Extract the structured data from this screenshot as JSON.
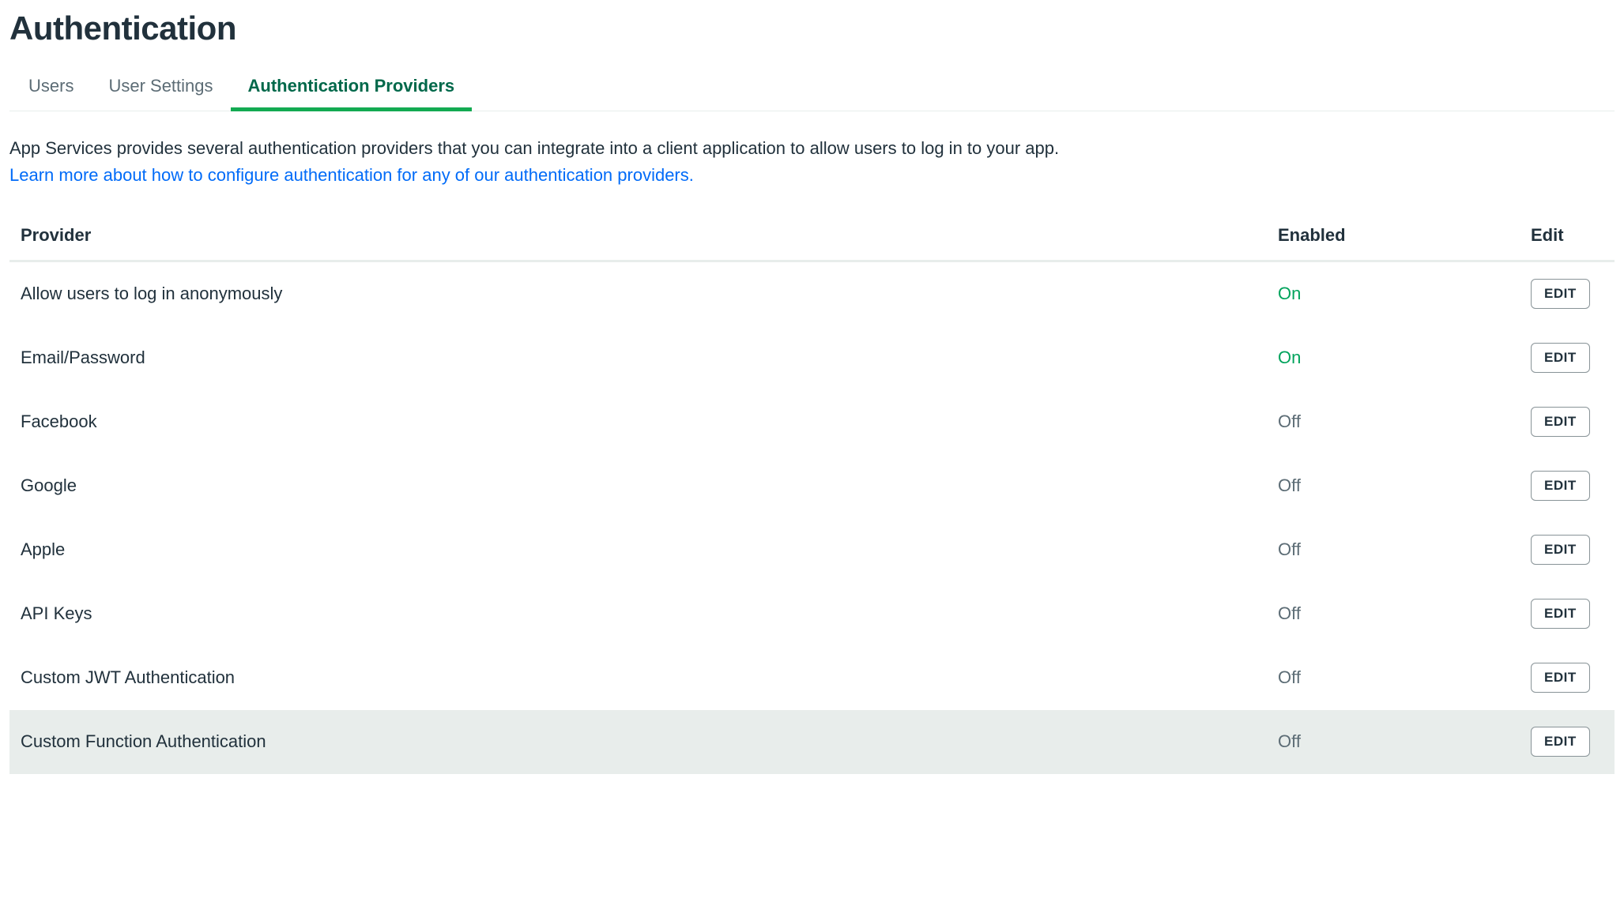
{
  "page": {
    "title": "Authentication"
  },
  "tabs": [
    {
      "label": "Users",
      "active": false
    },
    {
      "label": "User Settings",
      "active": false
    },
    {
      "label": "Authentication Providers",
      "active": true
    }
  ],
  "description": {
    "text": "App Services provides several authentication providers that you can integrate into a client application to allow users to log in to your app.",
    "link": "Learn more about how to configure authentication for any of our authentication providers."
  },
  "table": {
    "headers": {
      "provider": "Provider",
      "enabled": "Enabled",
      "edit": "Edit"
    },
    "editLabel": "EDIT",
    "rows": [
      {
        "provider": "Allow users to log in anonymously",
        "enabled": "On",
        "highlight": false
      },
      {
        "provider": "Email/Password",
        "enabled": "On",
        "highlight": false
      },
      {
        "provider": "Facebook",
        "enabled": "Off",
        "highlight": false
      },
      {
        "provider": "Google",
        "enabled": "Off",
        "highlight": false
      },
      {
        "provider": "Apple",
        "enabled": "Off",
        "highlight": false
      },
      {
        "provider": "API Keys",
        "enabled": "Off",
        "highlight": false
      },
      {
        "provider": "Custom JWT Authentication",
        "enabled": "Off",
        "highlight": false
      },
      {
        "provider": "Custom Function Authentication",
        "enabled": "Off",
        "highlight": true
      }
    ]
  }
}
